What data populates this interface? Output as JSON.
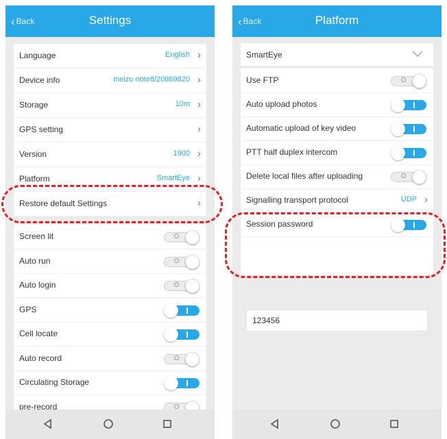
{
  "colors": {
    "accent": "#29a8e8",
    "highlight": "#e32027"
  },
  "left": {
    "back_label": "Back",
    "title": "Settings",
    "info_rows": [
      {
        "label": "Language",
        "value": "English"
      },
      {
        "label": "Device info",
        "value": "meizu note8/20869820"
      },
      {
        "label": "Storage",
        "value": "10m"
      },
      {
        "label": "GPS setting",
        "value": ""
      },
      {
        "label": "Version",
        "value": "1900"
      },
      {
        "label": "Platform",
        "value": "SmartEye"
      },
      {
        "label": "Restore default Settings",
        "value": ""
      }
    ],
    "toggle_rows": [
      {
        "label": "Screen lit",
        "state": "off"
      },
      {
        "label": "Auto run",
        "state": "off"
      },
      {
        "label": "Auto login",
        "state": "off"
      },
      {
        "label": "GPS",
        "state": "on"
      },
      {
        "label": "Cell locate",
        "state": "on"
      },
      {
        "label": "Auto record",
        "state": "off"
      },
      {
        "label": "Circulating Storage",
        "state": "on"
      },
      {
        "label": "pre-record",
        "state": "off"
      }
    ]
  },
  "right": {
    "back_label": "Back",
    "title": "Platform",
    "platform_select": "SmartEye",
    "rows": [
      {
        "label": "Use FTP",
        "type": "toggle",
        "state": "off"
      },
      {
        "label": "Auto upload photos",
        "type": "toggle",
        "state": "on"
      },
      {
        "label": "Automatic upload of key video",
        "type": "toggle",
        "state": "on"
      },
      {
        "label": "PTT half duplex intercom",
        "type": "toggle",
        "state": "on"
      },
      {
        "label": "Delete local files after uploading",
        "type": "toggle",
        "state": "off"
      },
      {
        "label": "Signalling transport protocol",
        "type": "link",
        "value": "UDP"
      },
      {
        "label": "Session password",
        "type": "toggle",
        "state": "on"
      }
    ],
    "password_value": "123456"
  },
  "icons": {
    "back": "chevron-left-icon",
    "nav": [
      "back-triangle-icon",
      "home-circle-icon",
      "recents-square-icon"
    ]
  }
}
